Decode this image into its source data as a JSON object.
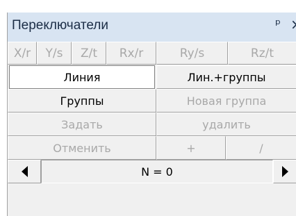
{
  "panel": {
    "title": "Переключатели"
  },
  "axes": [
    "X/r",
    "Y/s",
    "Z/t",
    "Rx/r",
    "Ry/s",
    "Rz/t"
  ],
  "modes": {
    "line": "Линия",
    "line_groups": "Лин.+группы"
  },
  "groups": {
    "groups": "Группы",
    "new_group": "Новая группа"
  },
  "actions": {
    "set": "Задать",
    "delete": "удалить",
    "cancel": "Отменить",
    "plus": "+",
    "slash": "/"
  },
  "status": {
    "counter": "N = 0"
  },
  "icons": {
    "pin": "pin-icon",
    "close": "close-icon",
    "prev": "arrow-left-icon",
    "next": "arrow-right-icon"
  }
}
